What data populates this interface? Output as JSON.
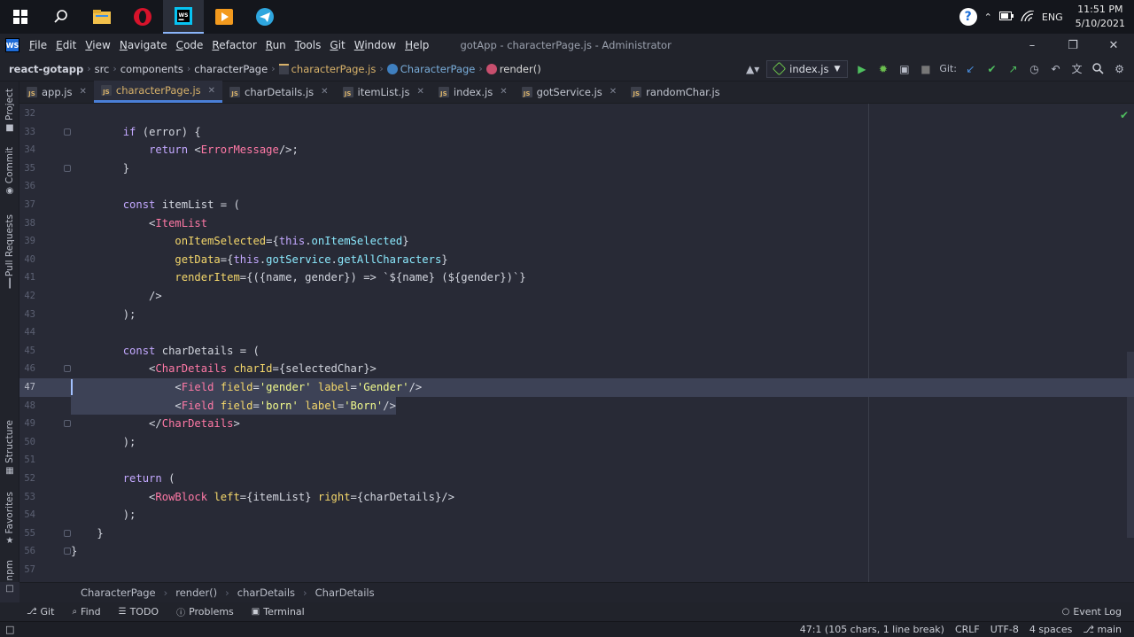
{
  "taskbar": {
    "apps": [
      {
        "name": "windows-start-icon"
      },
      {
        "name": "search-icon"
      },
      {
        "name": "file-explorer-icon"
      },
      {
        "name": "opera-icon"
      },
      {
        "name": "webstorm-icon",
        "active": true
      },
      {
        "name": "media-player-icon"
      },
      {
        "name": "telegram-icon"
      }
    ],
    "language": "ENG",
    "time": "11:51 PM",
    "date": "5/10/2021"
  },
  "menubar": {
    "logo": "WS",
    "items": [
      "File",
      "Edit",
      "View",
      "Navigate",
      "Code",
      "Refactor",
      "Run",
      "Tools",
      "Git",
      "Window",
      "Help"
    ],
    "window_title": "gotApp - characterPage.js - Administrator"
  },
  "navbar": {
    "project": "react-gotapp",
    "crumbs": [
      "src",
      "components",
      "characterPage"
    ],
    "file": "characterPage.js",
    "class": "CharacterPage",
    "method": "render()",
    "run_config": "index.js",
    "git_label": "Git:"
  },
  "tabs": [
    {
      "label": "app.js",
      "active": false
    },
    {
      "label": "characterPage.js",
      "active": true
    },
    {
      "label": "charDetails.js",
      "active": false
    },
    {
      "label": "itemList.js",
      "active": false
    },
    {
      "label": "index.js",
      "active": false
    },
    {
      "label": "gotService.js",
      "active": false
    },
    {
      "label": "randomChar.js",
      "active": false
    }
  ],
  "left_strip": [
    "Project",
    "Commit",
    "Pull Requests",
    "Structure",
    "Favorites",
    "npm"
  ],
  "editor": {
    "first_line": 32,
    "current_line": 47,
    "lines": [
      "",
      "        if (error) {",
      "            return <ErrorMessage/>;",
      "        }",
      "",
      "        const itemList = (",
      "            <ItemList",
      "                onItemSelected={this.onItemSelected}",
      "                getData={this.gotService.getAllCharacters}",
      "                renderItem={({name, gender}) => `${name} (${gender})`}",
      "            />",
      "        );",
      "",
      "        const charDetails = (",
      "            <CharDetails charId={selectedChar}>",
      "                <Field field='gender' label='Gender'/>",
      "                <Field field='born' label='Born'/>",
      "            </CharDetails>",
      "        );",
      "",
      "        return (",
      "            <RowBlock left={itemList} right={charDetails}/>",
      "        );",
      "    }",
      "}",
      ""
    ]
  },
  "editor_breadcrumbs": [
    "CharacterPage",
    "render()",
    "charDetails",
    "CharDetails"
  ],
  "tool_windows": [
    {
      "label": "Git",
      "icon": "git-icon"
    },
    {
      "label": "Find",
      "icon": "find-icon"
    },
    {
      "label": "TODO",
      "icon": "todo-icon"
    },
    {
      "label": "Problems",
      "icon": "problems-icon"
    },
    {
      "label": "Terminal",
      "icon": "terminal-icon"
    }
  ],
  "event_log": "Event Log",
  "status": {
    "position": "47:1 (105 chars, 1 line break)",
    "line_sep": "CRLF",
    "encoding": "UTF-8",
    "indent": "4 spaces",
    "branch": "main"
  }
}
